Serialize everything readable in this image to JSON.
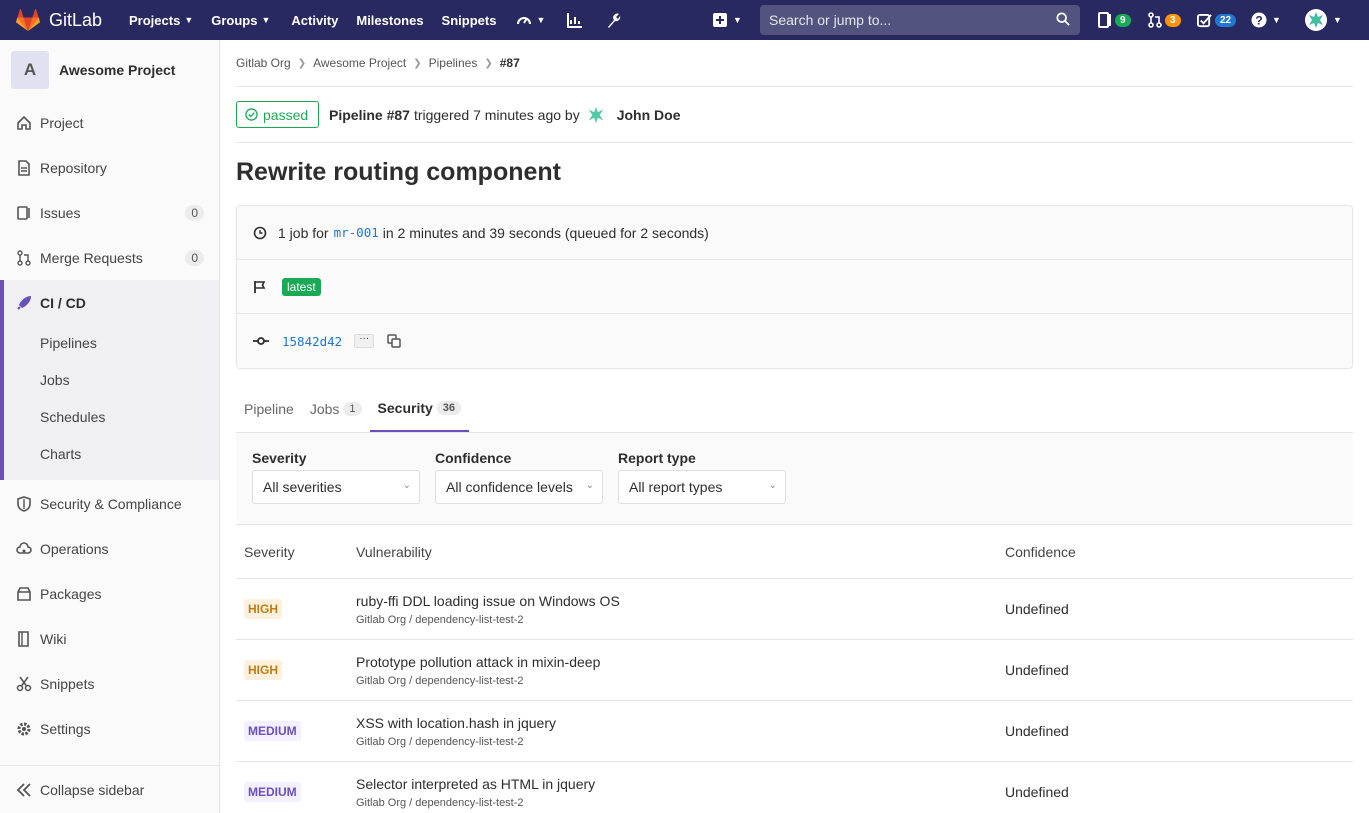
{
  "navbar": {
    "logo_text": "GitLab",
    "menu": [
      "Projects",
      "Groups",
      "Activity",
      "Milestones",
      "Snippets"
    ],
    "search_placeholder": "Search or jump to...",
    "issues_count": "9",
    "mr_count": "3",
    "todos_count": "22",
    "colors": {
      "bg": "#292961",
      "green": "#1aaa55",
      "orange": "#fc9403",
      "blue": "#1f78d1"
    }
  },
  "sidebar": {
    "project_initial": "A",
    "project_name": "Awesome Project",
    "items": [
      {
        "label": "Project",
        "icon": "home-icon"
      },
      {
        "label": "Repository",
        "icon": "doc-icon"
      },
      {
        "label": "Issues",
        "icon": "issues-icon",
        "count": "0"
      },
      {
        "label": "Merge Requests",
        "icon": "merge-request-icon",
        "count": "0"
      },
      {
        "label": "CI / CD",
        "icon": "rocket-icon"
      },
      {
        "label": "Security & Compliance",
        "icon": "shield-icon"
      },
      {
        "label": "Operations",
        "icon": "cloud-gear-icon"
      },
      {
        "label": "Packages",
        "icon": "package-icon"
      },
      {
        "label": "Wiki",
        "icon": "book-icon"
      },
      {
        "label": "Snippets",
        "icon": "scissors-icon"
      },
      {
        "label": "Settings",
        "icon": "gear-icon"
      }
    ],
    "cicd_sub": [
      "Pipelines",
      "Jobs",
      "Schedules",
      "Charts"
    ],
    "collapse_label": "Collapse sidebar"
  },
  "breadcrumb": [
    "Gitlab Org",
    "Awesome Project",
    "Pipelines",
    "#87"
  ],
  "pipeline": {
    "status": "passed",
    "id_label": "Pipeline #87",
    "triggered_text": "triggered 7 minutes ago by",
    "author": "John Doe",
    "title": "Rewrite routing component",
    "jobs_prefix": "1 job for",
    "ref": "mr-001",
    "duration_text": "in 2 minutes and 39 seconds (queued for 2 seconds)",
    "latest_badge": "latest",
    "commit_sha": "15842d42",
    "ellipsis": "···"
  },
  "tabs": [
    {
      "label": "Pipeline"
    },
    {
      "label": "Jobs",
      "count": "1"
    },
    {
      "label": "Security",
      "count": "36"
    }
  ],
  "filters": [
    {
      "label": "Severity",
      "value": "All severities"
    },
    {
      "label": "Confidence",
      "value": "All confidence levels"
    },
    {
      "label": "Report type",
      "value": "All report types"
    }
  ],
  "table": {
    "headers": [
      "Severity",
      "Vulnerability",
      "Confidence"
    ],
    "rows": [
      {
        "severity": "HIGH",
        "title": "ruby-ffi DDL loading issue on Windows OS",
        "project": "Gitlab Org / dependency-list-test-2",
        "confidence": "Undefined"
      },
      {
        "severity": "HIGH",
        "title": "Prototype pollution attack in mixin-deep",
        "project": "Gitlab Org / dependency-list-test-2",
        "confidence": "Undefined"
      },
      {
        "severity": "MEDIUM",
        "title": "XSS with location.hash in jquery",
        "project": "Gitlab Org / dependency-list-test-2",
        "confidence": "Undefined"
      },
      {
        "severity": "MEDIUM",
        "title": "Selector interpreted as HTML in jquery",
        "project": "Gitlab Org / dependency-list-test-2",
        "confidence": "Undefined"
      }
    ]
  }
}
